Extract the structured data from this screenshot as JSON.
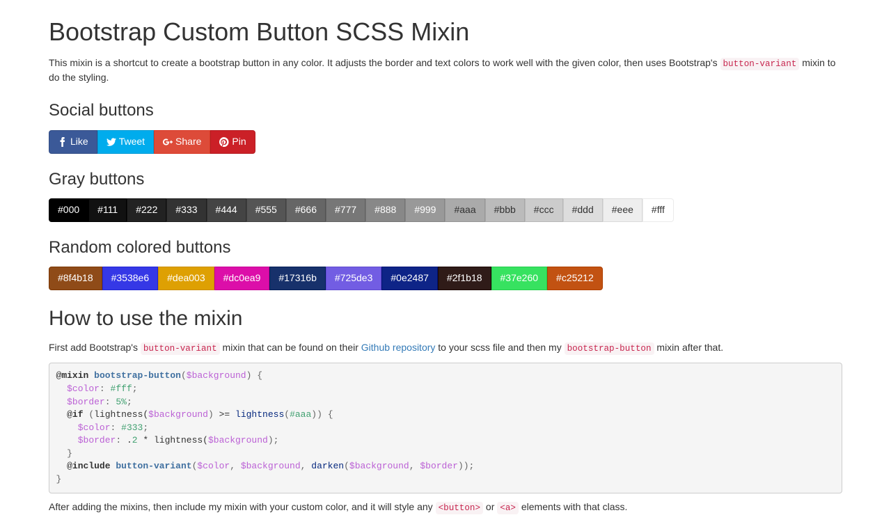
{
  "title": "Bootstrap Custom Button SCSS Mixin",
  "intro": {
    "part1": "This mixin is a shortcut to create a bootstrap button in any color. It adjusts the border and text colors to work well with the given color, then uses Bootstrap's ",
    "code": "button-variant",
    "part2": " mixin to do the styling."
  },
  "social_heading": "Social buttons",
  "social_buttons": [
    {
      "label": "Like",
      "bg": "#3b5998",
      "border": "#344e86",
      "icon": "facebook"
    },
    {
      "label": "Tweet",
      "bg": "#00aced",
      "border": "#0099d4",
      "icon": "twitter"
    },
    {
      "label": "Share",
      "bg": "#dd4b39",
      "border": "#d73925",
      "icon": "google-plus"
    },
    {
      "label": "Pin",
      "bg": "#cb2027",
      "border": "#b51d23",
      "icon": "pinterest"
    }
  ],
  "gray_heading": "Gray buttons",
  "gray_buttons": [
    {
      "label": "#000",
      "bg": "#000000",
      "fg": "#fff"
    },
    {
      "label": "#111",
      "bg": "#111111",
      "fg": "#fff"
    },
    {
      "label": "#222",
      "bg": "#222222",
      "fg": "#fff"
    },
    {
      "label": "#333",
      "bg": "#333333",
      "fg": "#fff"
    },
    {
      "label": "#444",
      "bg": "#444444",
      "fg": "#fff"
    },
    {
      "label": "#555",
      "bg": "#555555",
      "fg": "#fff"
    },
    {
      "label": "#666",
      "bg": "#666666",
      "fg": "#fff"
    },
    {
      "label": "#777",
      "bg": "#777777",
      "fg": "#fff"
    },
    {
      "label": "#888",
      "bg": "#888888",
      "fg": "#fff"
    },
    {
      "label": "#999",
      "bg": "#999999",
      "fg": "#fff"
    },
    {
      "label": "#aaa",
      "bg": "#aaaaaa",
      "fg": "#333"
    },
    {
      "label": "#bbb",
      "bg": "#bbbbbb",
      "fg": "#333"
    },
    {
      "label": "#ccc",
      "bg": "#cccccc",
      "fg": "#333"
    },
    {
      "label": "#ddd",
      "bg": "#dddddd",
      "fg": "#333"
    },
    {
      "label": "#eee",
      "bg": "#eeeeee",
      "fg": "#333"
    },
    {
      "label": "#fff",
      "bg": "#ffffff",
      "fg": "#333"
    }
  ],
  "random_heading": "Random colored buttons",
  "random_buttons": [
    {
      "label": "#8f4b18",
      "bg": "#8f4b18",
      "fg": "#fff"
    },
    {
      "label": "#3538e6",
      "bg": "#3538e6",
      "fg": "#fff"
    },
    {
      "label": "#dea003",
      "bg": "#dea003",
      "fg": "#fff"
    },
    {
      "label": "#dc0ea9",
      "bg": "#dc0ea9",
      "fg": "#fff"
    },
    {
      "label": "#17316b",
      "bg": "#17316b",
      "fg": "#fff"
    },
    {
      "label": "#725de3",
      "bg": "#725de3",
      "fg": "#fff"
    },
    {
      "label": "#0e2487",
      "bg": "#0e2487",
      "fg": "#fff"
    },
    {
      "label": "#2f1b18",
      "bg": "#2f1b18",
      "fg": "#fff"
    },
    {
      "label": "#37e260",
      "bg": "#37e260",
      "fg": "#fff"
    },
    {
      "label": "#c25212",
      "bg": "#c25212",
      "fg": "#fff"
    }
  ],
  "howto_heading": "How to use the mixin",
  "howto_intro": {
    "part1": "First add Bootstrap's ",
    "code1": "button-variant",
    "part2": " mixin that can be found on their ",
    "link_text": "Github repository",
    "part3": " to your scss file and then my ",
    "code2": "bootstrap-button",
    "part4": " mixin after that."
  },
  "code_tokens": [
    [
      "at",
      "@"
    ],
    [
      "kw",
      "mixin"
    ],
    [
      "sp",
      " "
    ],
    [
      "name",
      "bootstrap-button"
    ],
    [
      "p",
      "("
    ],
    [
      "var",
      "$background"
    ],
    [
      "p",
      ")"
    ],
    [
      "sp",
      " "
    ],
    [
      "p",
      "{"
    ],
    [
      "nl"
    ],
    [
      "sp",
      "  "
    ],
    [
      "var",
      "$color"
    ],
    [
      "p",
      ":"
    ],
    [
      "sp",
      " "
    ],
    [
      "hex",
      "#fff"
    ],
    [
      "p",
      ";"
    ],
    [
      "nl"
    ],
    [
      "sp",
      "  "
    ],
    [
      "var",
      "$border"
    ],
    [
      "p",
      ":"
    ],
    [
      "sp",
      " "
    ],
    [
      "num",
      "5%"
    ],
    [
      "p",
      ";"
    ],
    [
      "nl"
    ],
    [
      "sp",
      "  "
    ],
    [
      "at",
      "@"
    ],
    [
      "kw",
      "if"
    ],
    [
      "sp",
      " "
    ],
    [
      "p",
      "("
    ],
    [
      "txt",
      "lightness("
    ],
    [
      "var",
      "$background"
    ],
    [
      "p",
      ")"
    ],
    [
      "sp",
      " >= "
    ],
    [
      "fn",
      "lightness"
    ],
    [
      "p",
      "("
    ],
    [
      "hex",
      "#aaa"
    ],
    [
      "p",
      ")) "
    ],
    [
      "p",
      "{"
    ],
    [
      "nl"
    ],
    [
      "sp",
      "    "
    ],
    [
      "var",
      "$color"
    ],
    [
      "p",
      ":"
    ],
    [
      "sp",
      " "
    ],
    [
      "hex",
      "#333"
    ],
    [
      "p",
      ";"
    ],
    [
      "nl"
    ],
    [
      "sp",
      "    "
    ],
    [
      "var",
      "$border"
    ],
    [
      "p",
      ":"
    ],
    [
      "sp",
      " ."
    ],
    [
      "num",
      "2"
    ],
    [
      "txt",
      " * lightness("
    ],
    [
      "var",
      "$background"
    ],
    [
      "p",
      ");"
    ],
    [
      "nl"
    ],
    [
      "sp",
      "  "
    ],
    [
      "p",
      "}"
    ],
    [
      "nl"
    ],
    [
      "sp",
      "  "
    ],
    [
      "at",
      "@"
    ],
    [
      "kw",
      "include"
    ],
    [
      "sp",
      " "
    ],
    [
      "name",
      "button-variant"
    ],
    [
      "p",
      "("
    ],
    [
      "var",
      "$color"
    ],
    [
      "p",
      ","
    ],
    [
      "sp",
      " "
    ],
    [
      "var",
      "$background"
    ],
    [
      "p",
      ","
    ],
    [
      "sp",
      " "
    ],
    [
      "fn",
      "darken"
    ],
    [
      "p",
      "("
    ],
    [
      "var",
      "$background"
    ],
    [
      "p",
      ","
    ],
    [
      "sp",
      " "
    ],
    [
      "var",
      "$border"
    ],
    [
      "p",
      "));"
    ],
    [
      "nl"
    ],
    [
      "p",
      "}"
    ]
  ],
  "after_code": {
    "part1": "After adding the mixins, then include my mixin with your custom color, and it will style any ",
    "code1": "<button>",
    "part2": " or ",
    "code2": "<a>",
    "part3": " elements with that class."
  }
}
